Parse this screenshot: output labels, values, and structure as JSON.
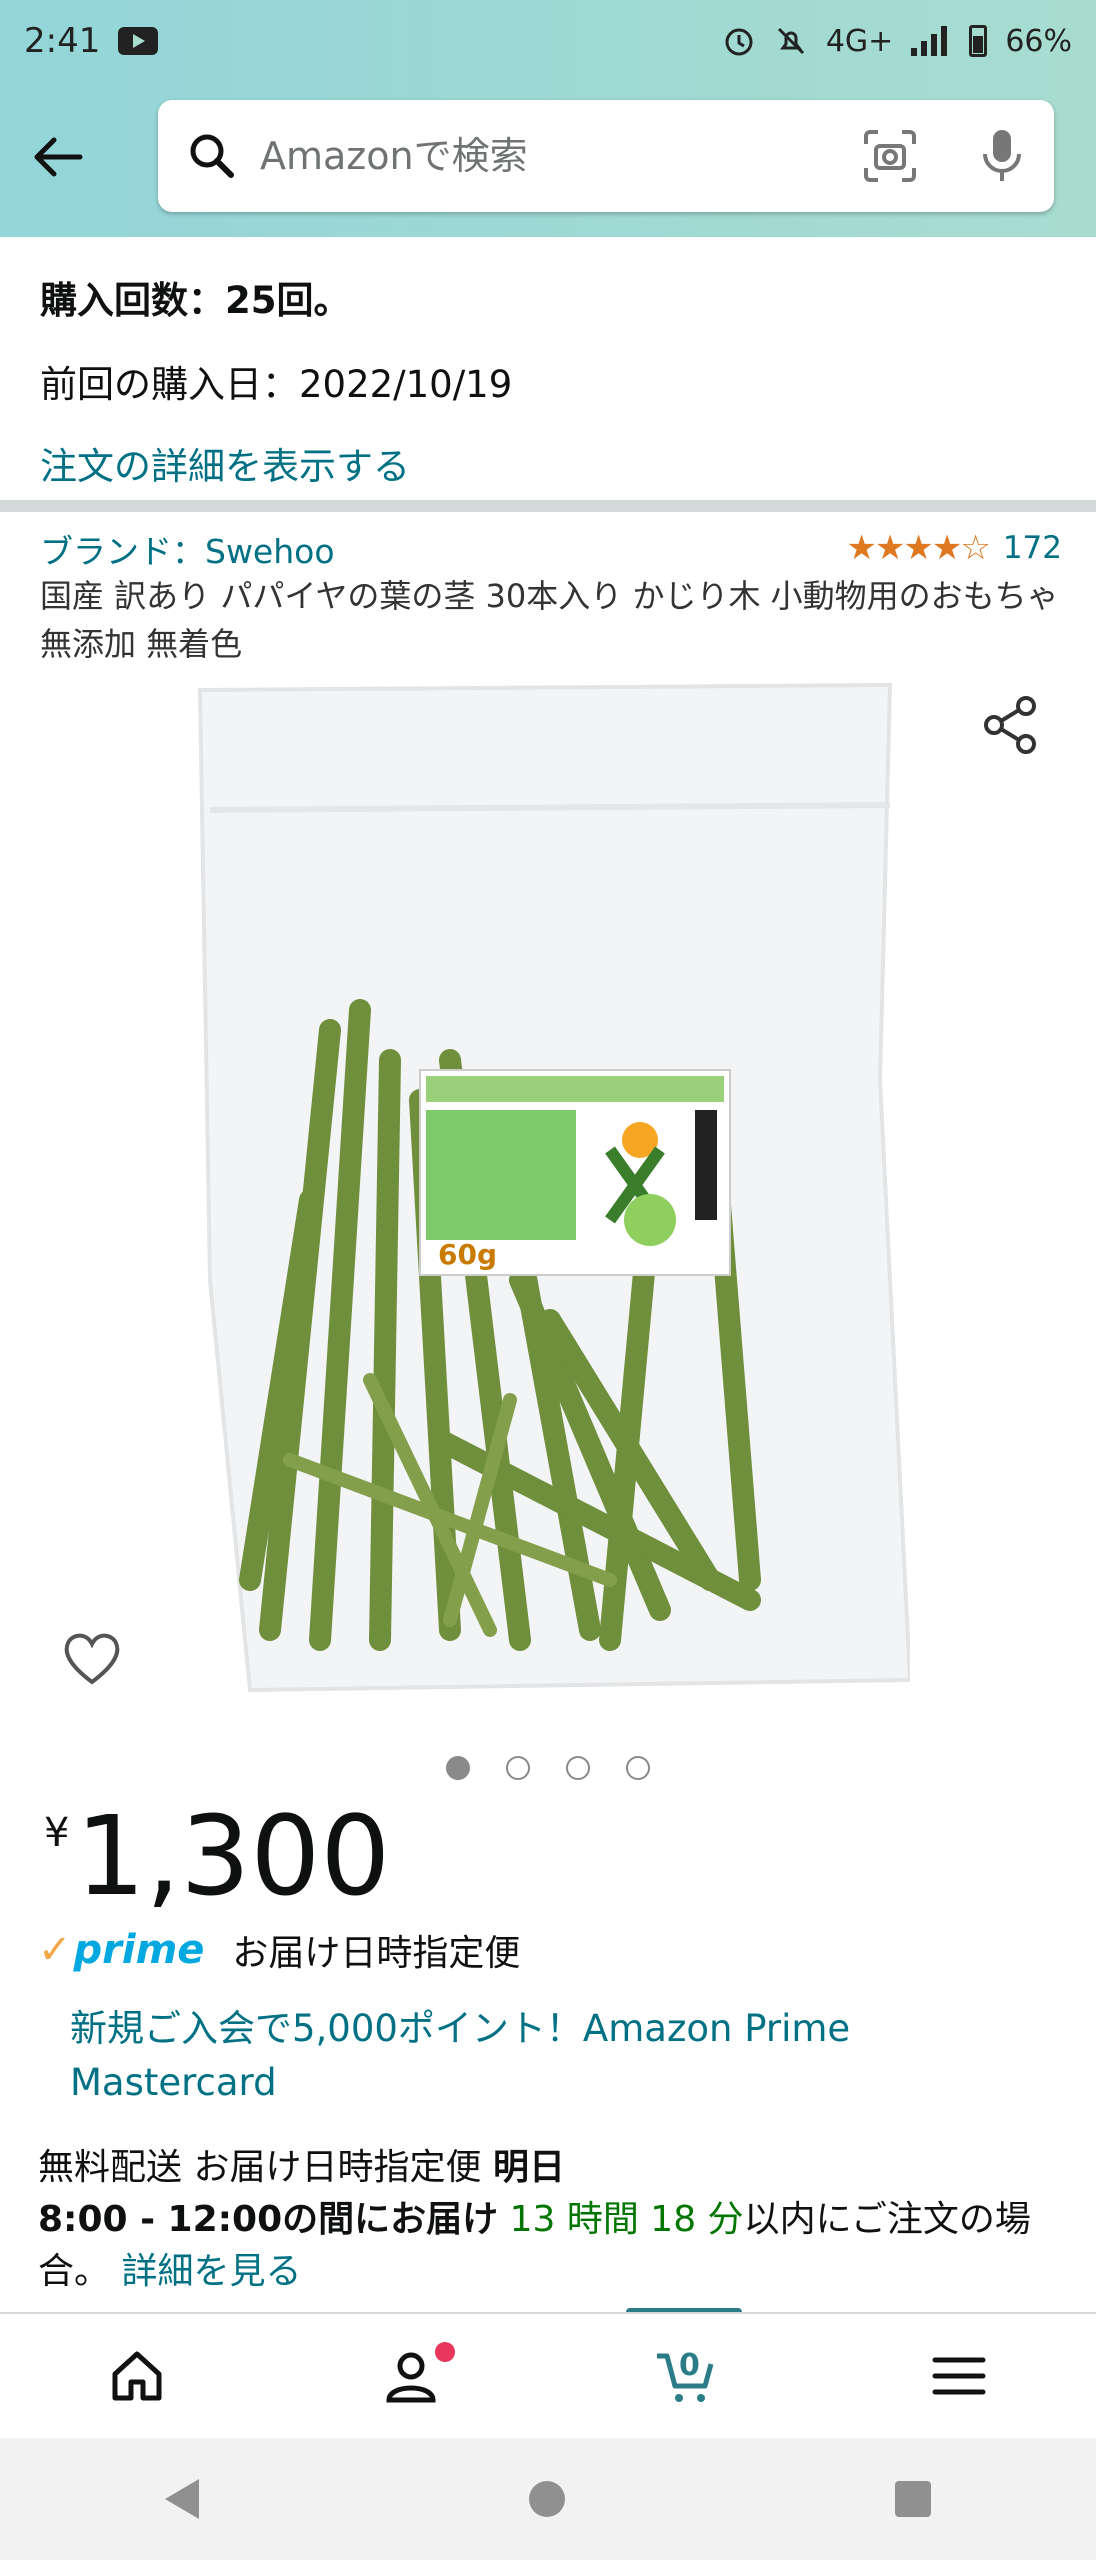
{
  "status_bar": {
    "time": "2:41",
    "network": "4G+",
    "battery": "66%"
  },
  "search": {
    "placeholder": "Amazonで検索"
  },
  "purchase_history": {
    "count": "購入回数：25回。",
    "last_date": "前回の購入日：2022/10/19",
    "details_link": "注文の詳細を表示する"
  },
  "product": {
    "brand": "ブランド：Swehoo",
    "stars": "★★★★☆",
    "rating_count": "172",
    "title": "国産 訳あり パパイヤの葉の茎 30本入り かじり木 小動物用のおもちゃ 無添加 無着色",
    "image_count": 4,
    "active_image": 1
  },
  "price": {
    "currency": "¥",
    "amount": "1,300"
  },
  "prime": {
    "logo": "prime",
    "text": "お届け日時指定便"
  },
  "promo": {
    "text": "新規ご入会で5,000ポイント！Amazon Prime Mastercard"
  },
  "delivery": {
    "free_shipping": "無料配送",
    "service": "お届け日時指定便",
    "day": "明日",
    "window": "8:00 - 12:00の間にお届け",
    "countdown": "13 時間 18 分",
    "suffix": "以内にご注文の場合。",
    "details_link": "詳細を見る"
  },
  "bottom_nav": {
    "cart_count": "0"
  },
  "colors": {
    "header_gradient_start": "#93d5d9",
    "header_gradient_end": "#a8dccf",
    "link": "#007185",
    "star": "#de7921",
    "prime_blue": "#00a8e1",
    "green": "#007600",
    "cart_accent": "#2c7c88"
  }
}
